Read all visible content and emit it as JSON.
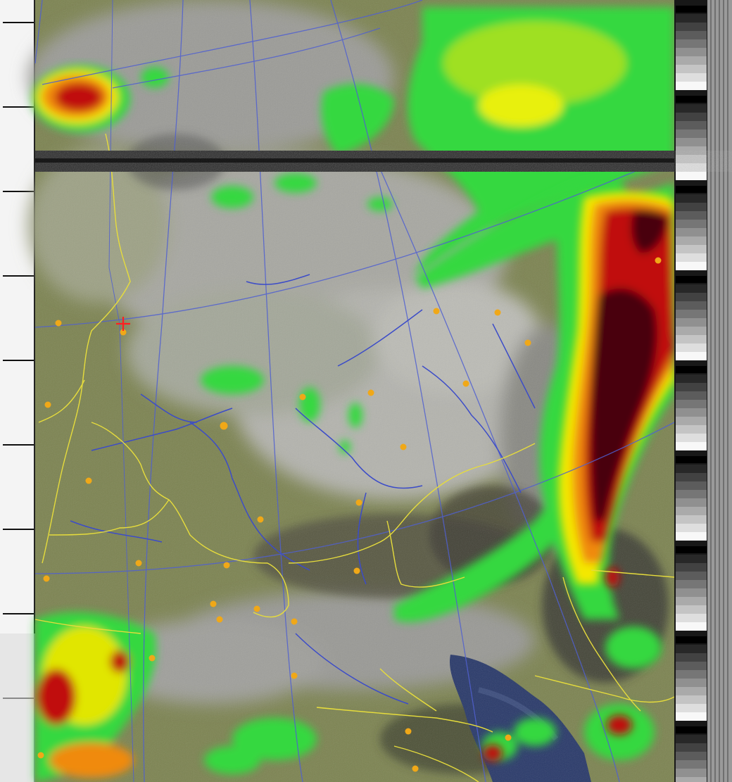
{
  "image": {
    "kind": "NOAA APT satellite weather image (false-color enhanced)",
    "colors": {
      "land_base": "#7d8452",
      "land_light": "#a7ab86",
      "cloud_gray": "#b8b8b2",
      "water": "#2a3a6a",
      "precip_green": "#35e040",
      "precip_yellow": "#f4f000",
      "precip_orange": "#f08a10",
      "precip_red": "#c01010",
      "precip_darkred": "#4a0608",
      "border_yellow": "#e6dc3c",
      "grid_blue": "#5060d0",
      "river_blue": "#3c4cc8",
      "city_orange": "#f0a818",
      "marker_red": "#ff2020"
    },
    "icons": {
      "city": "city-dot-icon",
      "marker": "crosshair-marker-icon"
    }
  },
  "cities": [
    {
      "id": "c1"
    },
    {
      "id": "c2"
    },
    {
      "id": "c3"
    },
    {
      "id": "c4"
    },
    {
      "id": "c5"
    },
    {
      "id": "c6"
    },
    {
      "id": "c7"
    },
    {
      "id": "c8"
    },
    {
      "id": "c9"
    },
    {
      "id": "c10"
    },
    {
      "id": "c11"
    },
    {
      "id": "c12"
    },
    {
      "id": "c13"
    },
    {
      "id": "c14"
    },
    {
      "id": "c15"
    },
    {
      "id": "c16"
    },
    {
      "id": "c17"
    },
    {
      "id": "c18"
    },
    {
      "id": "c19"
    },
    {
      "id": "c20"
    },
    {
      "id": "c21"
    },
    {
      "id": "c22"
    },
    {
      "id": "c23"
    },
    {
      "id": "c24"
    },
    {
      "id": "c25"
    },
    {
      "id": "c26"
    },
    {
      "id": "c27"
    },
    {
      "id": "c28"
    },
    {
      "id": "c29"
    }
  ]
}
